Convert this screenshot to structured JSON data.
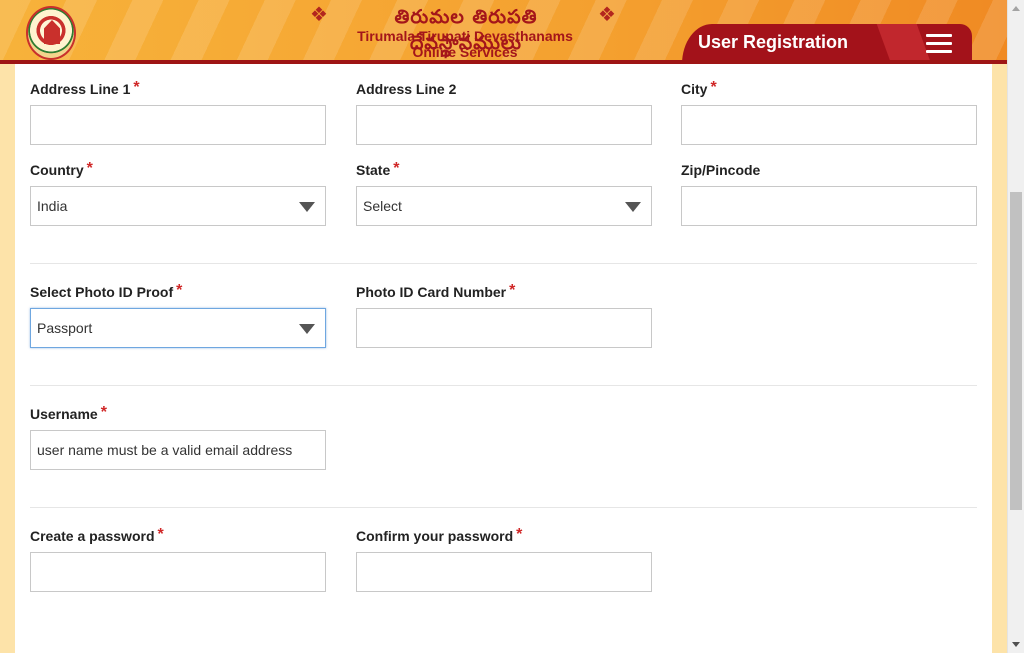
{
  "header": {
    "telugu_title": "తిరుమల తిరుపతి దేవస్థానములు",
    "title_line1": "Tirumala Tirupati Devasthanams",
    "title_line2": "Online Services",
    "page_title": "User Registration"
  },
  "colors": {
    "header_accent": "#a3121a",
    "required_star": "#d02727",
    "page_bg": "#fde3a9"
  },
  "icons": {
    "logo": "ttd-emblem-icon",
    "menu": "hamburger-menu-icon",
    "dropdown": "caret-down-icon"
  },
  "form": {
    "address_line1": {
      "label": "Address Line 1",
      "required": "*",
      "value": ""
    },
    "address_line2": {
      "label": "Address Line 2",
      "value": ""
    },
    "city": {
      "label": "City",
      "required": "*",
      "value": ""
    },
    "country": {
      "label": "Country",
      "required": "*",
      "value": "India"
    },
    "state": {
      "label": "State",
      "required": "*",
      "value": "Select"
    },
    "zip": {
      "label": "Zip/Pincode",
      "value": ""
    },
    "photo_id_proof": {
      "label": "Select Photo ID Proof",
      "required": "*",
      "value": "Passport"
    },
    "photo_id_number": {
      "label": "Photo ID Card Number",
      "required": "*",
      "value": ""
    },
    "username": {
      "label": "Username",
      "required": "*",
      "placeholder": "user name must be a valid email address"
    },
    "password": {
      "label": "Create a password",
      "required": "*",
      "value": ""
    },
    "confirm_password": {
      "label": "Confirm your password",
      "required": "*",
      "value": ""
    }
  }
}
